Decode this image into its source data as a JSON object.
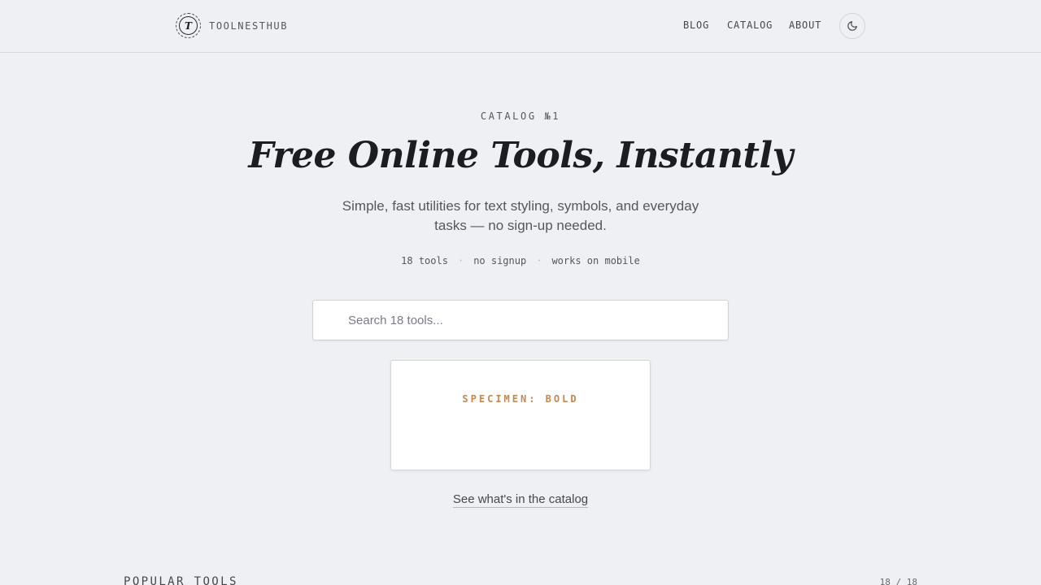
{
  "header": {
    "logo_letter": "T",
    "brand": "TOOLNESTHUB",
    "nav": {
      "blog": "BLOG",
      "catalog": "CATALOG",
      "about": "ABOUT"
    },
    "theme_toggle_icon": "moon-icon"
  },
  "hero": {
    "eyebrow": "CATALOG №1",
    "title": "Free Online Tools, Instantly",
    "subtitle": "Simple, fast utilities for text styling, symbols, and everyday tasks — no sign-up needed.",
    "meta": [
      "18 tools",
      "no signup",
      "works on mobile"
    ],
    "meta_separator": "·"
  },
  "search": {
    "icon": "search-icon",
    "placeholder": "Search 18 tools..."
  },
  "specimen": {
    "label": "SPECIMEN: BOLD"
  },
  "catalog_link": "See what's in the catalog",
  "popular": {
    "title": "POPULAR TOOLS",
    "count": "18 / 18"
  },
  "colors": {
    "background": "#eff0f4",
    "accent": "#c2884f",
    "text": "#1c1d22",
    "muted": "#55575f"
  }
}
